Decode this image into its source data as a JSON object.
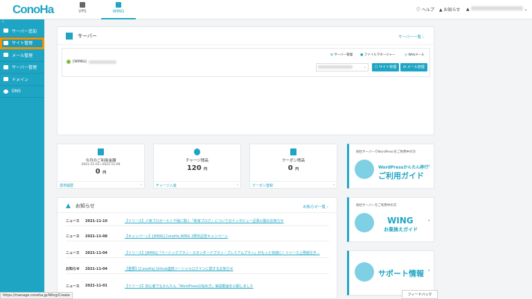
{
  "header": {
    "logo": "ConoHa",
    "tabs": [
      {
        "label": "VPS"
      },
      {
        "label": "WING"
      }
    ],
    "help": "ヘルプ",
    "notifications": "お知らせ"
  },
  "sidebar": {
    "collapse": "‹",
    "items": [
      {
        "label": "サーバー追加"
      },
      {
        "label": "サイト管理"
      },
      {
        "label": "メール管理"
      },
      {
        "label": "サーバー管理"
      },
      {
        "label": "ドメイン"
      },
      {
        "label": "DNS"
      }
    ]
  },
  "server": {
    "title": "サーバー",
    "list_link": "サーバー一覧 ›",
    "name": "[WING]",
    "links": [
      "サーバー管理",
      "ファイルマネージャー",
      "Webメール"
    ],
    "site_btn": "サイト管理",
    "mail_btn": "メール管理"
  },
  "stats": [
    {
      "label": "今月のご利用金額",
      "date": "2021-11-01~2021-11-09",
      "value": "0",
      "unit": "円",
      "foot": "請求履歴"
    },
    {
      "label": "チャージ残高",
      "value": "120",
      "unit": "円",
      "foot": "チャージ入金"
    },
    {
      "label": "クーポン残高",
      "value": "0",
      "unit": "円",
      "foot": "クーポン登録"
    }
  ],
  "news": {
    "title": "お知らせ",
    "list_link": "お知らせ一覧 ›",
    "items": [
      {
        "cat": "ニュース",
        "date": "2021-11-10",
        "title": "【リリース】人気ブロガーヒトデ様に聞く「新家ブログ」についてのインタビュー記事公開のお知らせ"
      },
      {
        "cat": "ニュース",
        "date": "2021-11-08",
        "title": "【キャンペーン】[WING] ConoHa WING 3周年記念キャンペーン"
      },
      {
        "cat": "ニュース",
        "date": "2021-11-04",
        "title": "【リリース】[WING]「ベーシックプラン・スタンダードプラン・プレミアムプラン」がもっと快適に！リソース上限値引き…"
      },
      {
        "cat": "お知らせ",
        "date": "2021-11-04",
        "title": "【重要】[ConoHa] Github連携ソーシャルログインに関するお知らせ"
      },
      {
        "cat": "ニュース",
        "date": "2021-11-01",
        "title": "【リリース】初心者でもかんたん「WordPressの始め方」解説動画を公開しました"
      }
    ]
  },
  "promos": [
    {
      "sub": "他社サーバーでWordPressをご利用中の方",
      "line1": "WordPressかんたん移行",
      "line2": "ご利用ガイド"
    },
    {
      "sub": "他社サーバーをご利用中の方",
      "line1": "WING",
      "line2": "お乗換えガイド"
    },
    {
      "line1": "サポート情報"
    }
  ],
  "status_url": "https://manage.conoha.jp/Wing/Create",
  "feedback": "フィードバック"
}
